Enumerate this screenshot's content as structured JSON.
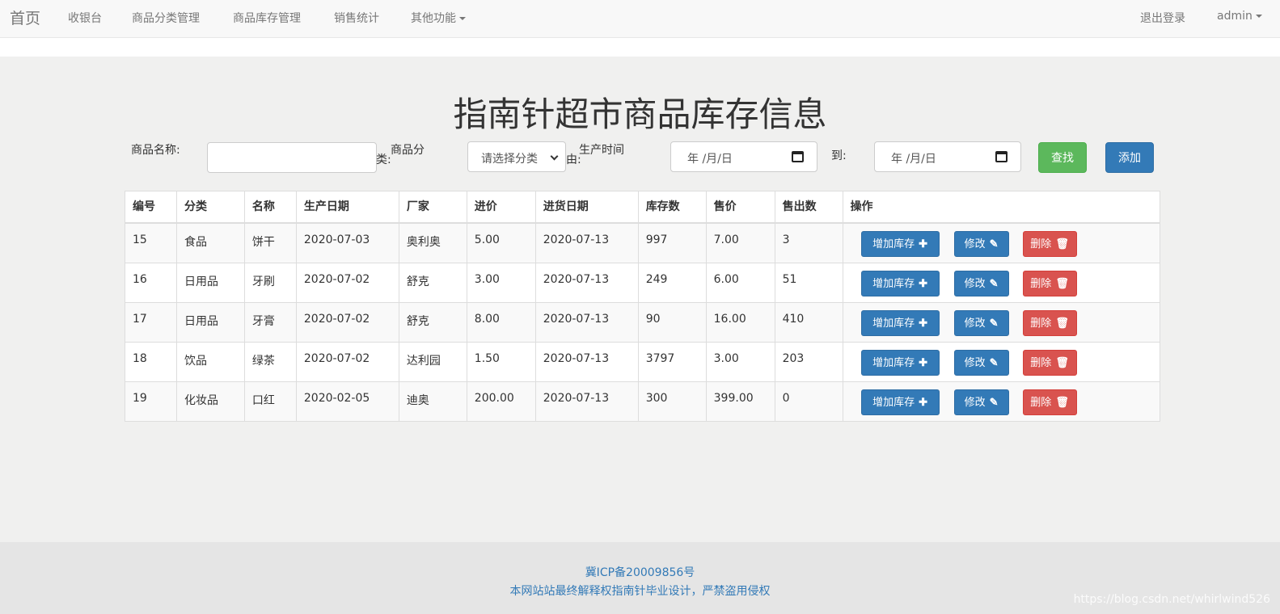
{
  "navbar": {
    "brand": "首页",
    "items": [
      "收银台",
      "商品分类管理",
      "商品库存管理",
      "销售统计",
      "其他功能"
    ],
    "logout": "退出登录",
    "user": "admin"
  },
  "page_title": "指南针超市商品库存信息",
  "search": {
    "name_label": "商品名称:",
    "category_label": "商品分类:",
    "category_value": "请选择分类",
    "time_label": "生产时间由:",
    "to_label": "到:",
    "date_placeholder": "年 /月/日",
    "find_button": "查找",
    "add_button": "添加"
  },
  "table": {
    "headers": [
      "编号",
      "分类",
      "名称",
      "生产日期",
      "厂家",
      "进价",
      "进货日期",
      "库存数",
      "售价",
      "售出数",
      "操作"
    ],
    "rows": [
      [
        "15",
        "食品",
        "饼干",
        "2020-07-03",
        "奥利奥",
        "5.00",
        "2020-07-13",
        "997",
        "7.00",
        "3"
      ],
      [
        "16",
        "日用品",
        "牙刷",
        "2020-07-02",
        "舒克",
        "3.00",
        "2020-07-13",
        "249",
        "6.00",
        "51"
      ],
      [
        "17",
        "日用品",
        "牙膏",
        "2020-07-02",
        "舒克",
        "8.00",
        "2020-07-13",
        "90",
        "16.00",
        "410"
      ],
      [
        "18",
        "饮品",
        "绿茶",
        "2020-07-02",
        "达利园",
        "1.50",
        "2020-07-13",
        "3797",
        "3.00",
        "203"
      ],
      [
        "19",
        "化妆品",
        "口红",
        "2020-02-05",
        "迪奥",
        "200.00",
        "2020-07-13",
        "300",
        "399.00",
        "0"
      ]
    ],
    "actions": {
      "add_stock": "增加库存",
      "edit": "修改",
      "delete": "删除"
    }
  },
  "footer": {
    "icp": "冀ICP备20009856号",
    "notice": "本网站站最终解释权指南针毕业设计，严禁盗用侵权"
  },
  "watermark": "https://blog.csdn.net/whirlwind526",
  "colors": {
    "primary": "#337ab7",
    "success": "#5cb85c",
    "danger": "#d9534f"
  }
}
